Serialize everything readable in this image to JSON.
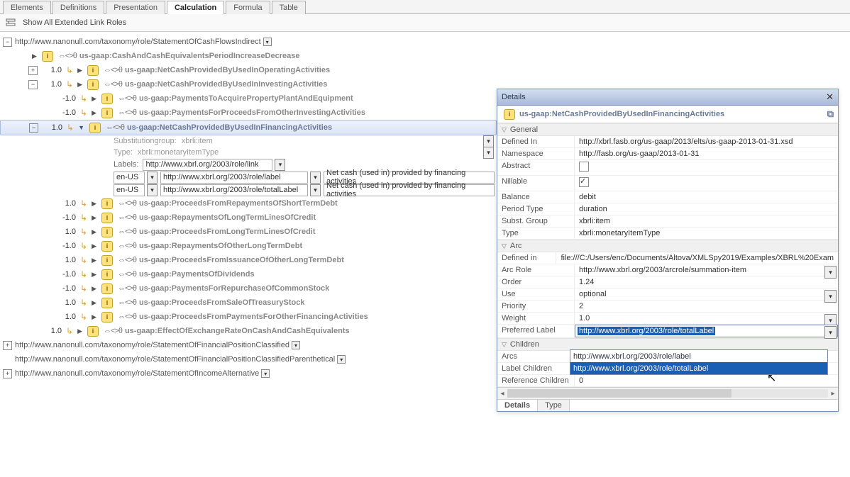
{
  "tabs": [
    "Elements",
    "Definitions",
    "Presentation",
    "Calculation",
    "Formula",
    "Table"
  ],
  "active_tab": "Calculation",
  "toolbar": {
    "show_all": "Show All Extended Link Roles"
  },
  "roles": {
    "r1": "http://www.nanonull.com/taxonomy/role/StatementOfCashFlowsIndirect",
    "r2": "http://www.nanonull.com/taxonomy/role/StatementOfFinancialPositionClassified",
    "r3": "http://www.nanonull.com/taxonomy/role/StatementOfFinancialPositionClassifiedParenthetical",
    "r4": "http://www.nanonull.com/taxonomy/role/StatementOfIncomeAlternative"
  },
  "nodes": {
    "n0": "us-gaap:CashAndCashEquivalentsPeriodIncreaseDecrease",
    "n1": "us-gaap:NetCashProvidedByUsedInOperatingActivities",
    "n2": "us-gaap:NetCashProvidedByUsedInInvestingActivities",
    "n3": "us-gaap:PaymentsToAcquirePropertyPlantAndEquipment",
    "n4": "us-gaap:PaymentsForProceedsFromOtherInvestingActivities",
    "n5": "us-gaap:NetCashProvidedByUsedInFinancingActivities",
    "n6": "us-gaap:ProceedsFromRepaymentsOfShortTermDebt",
    "n7": "us-gaap:RepaymentsOfLongTermLinesOfCredit",
    "n8": "us-gaap:ProceedsFromLongTermLinesOfCredit",
    "n9": "us-gaap:RepaymentsOfOtherLongTermDebt",
    "n10": "us-gaap:ProceedsFromIssuanceOfOtherLongTermDebt",
    "n11": "us-gaap:PaymentsOfDividends",
    "n12": "us-gaap:PaymentsForRepurchaseOfCommonStock",
    "n13": "us-gaap:ProceedsFromSaleOfTreasuryStock",
    "n14": "us-gaap:ProceedsFromPaymentsForOtherFinancingActivities",
    "n15": "us-gaap:EffectOfExchangeRateOnCashAndCashEquivalents"
  },
  "weights": {
    "w10p": "1.0",
    "w10n": "-1.0"
  },
  "selected": {
    "subst_lbl": "Substitutiongroup:",
    "subst_val": "xbrli:item",
    "type_lbl": "Type:",
    "type_val": "xbrli:monetaryItemType",
    "labels_lbl": "Labels:",
    "labels_uri": "http://www.xbrl.org/2003/role/link",
    "lang": "en-US",
    "role_label": "http://www.xbrl.org/2003/role/label",
    "role_total": "http://www.xbrl.org/2003/role/totalLabel",
    "lbl_text": "Net cash (used in) provided by financing activities"
  },
  "panel": {
    "title": "Details",
    "concept": "us-gaap:NetCashProvidedByUsedInFinancingActivities",
    "sections": {
      "general": "General",
      "arc": "Arc",
      "children": "Children"
    },
    "general": {
      "DefinedIn_k": "Defined In",
      "DefinedIn_v": "http://xbrl.fasb.org/us-gaap/2013/elts/us-gaap-2013-01-31.xsd",
      "Namespace_k": "Namespace",
      "Namespace_v": "http://fasb.org/us-gaap/2013-01-31",
      "Abstract_k": "Abstract",
      "Nillable_k": "Nillable",
      "Balance_k": "Balance",
      "Balance_v": "debit",
      "PeriodType_k": "Period Type",
      "PeriodType_v": "duration",
      "SubstGroup_k": "Subst. Group",
      "SubstGroup_v": "xbrli:item",
      "Type_k": "Type",
      "Type_v": "xbrli:monetaryItemType"
    },
    "arc": {
      "DefinedIn_k": "Defined in",
      "DefinedIn_v": "file:///C:/Users/enc/Documents/Altova/XMLSpy2019/Examples/XBRL%20Exam",
      "ArcRole_k": "Arc Role",
      "ArcRole_v": "http://www.xbrl.org/2003/arcrole/summation-item",
      "Order_k": "Order",
      "Order_v": "1.24",
      "Use_k": "Use",
      "Use_v": "optional",
      "Priority_k": "Priority",
      "Priority_v": "2",
      "Weight_k": "Weight",
      "Weight_v": "1.0",
      "PreferredLabel_k": "Preferred Label",
      "PreferredLabel_v": "http://www.xbrl.org/2003/role/totalLabel"
    },
    "children": {
      "Arcs_k": "Arcs",
      "LabelChildren_k": "Label Children",
      "RefChildren_k": "Reference Children",
      "RefChildren_v": "0"
    },
    "dropdown": {
      "opt1": "http://www.xbrl.org/2003/role/label",
      "opt2": "http://www.xbrl.org/2003/role/totalLabel"
    },
    "tabs": {
      "details": "Details",
      "type": "Type"
    }
  }
}
